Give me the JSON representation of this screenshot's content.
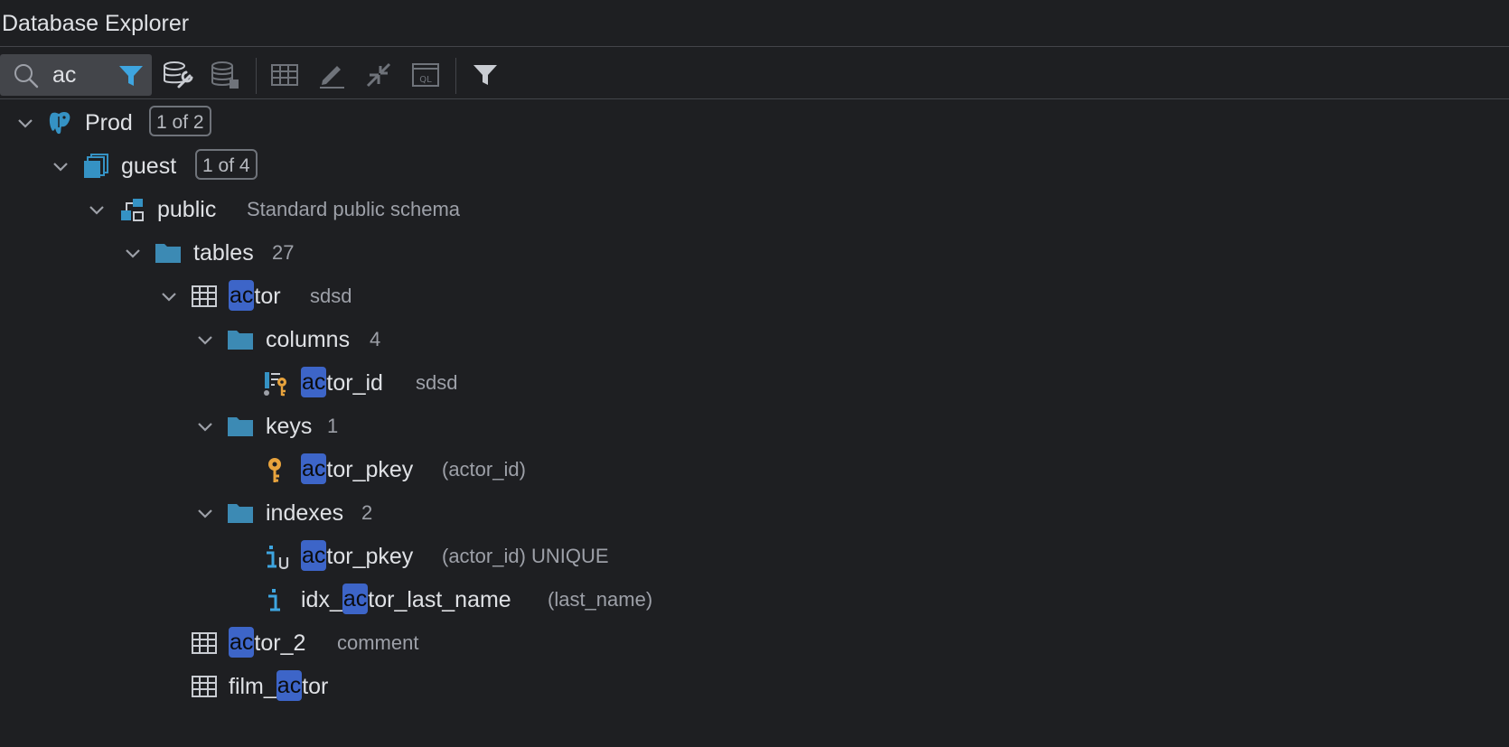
{
  "window": {
    "title": "Database Explorer"
  },
  "search": {
    "value": "ac"
  },
  "colors": {
    "accent": "#3d65c8",
    "icon_blue": "#3592c4",
    "key_yellow": "#e8a33d",
    "bg": "#1e1f22"
  },
  "toolbar": {
    "icons": [
      "data-source-properties-icon",
      "database-icon",
      "table-icon",
      "edit-icon",
      "jump-to-icon",
      "sql-console-icon",
      "filter-icon"
    ]
  },
  "tree": {
    "prod": {
      "label": "Prod",
      "badge": "1 of 2"
    },
    "guest": {
      "label": "guest",
      "badge": "1 of 4"
    },
    "public": {
      "label": "public",
      "comment": "Standard public schema"
    },
    "tables": {
      "label": "tables",
      "count": "27"
    },
    "actor": {
      "match": "ac",
      "rest": "tor",
      "comment": "sdsd"
    },
    "columns": {
      "label": "columns",
      "count": "4"
    },
    "actor_id": {
      "match": "ac",
      "rest": "tor_id",
      "comment": "sdsd"
    },
    "keys": {
      "label": "keys",
      "count": "1"
    },
    "actor_pkey_key": {
      "match": "ac",
      "rest": "tor_pkey",
      "comment": "(actor_id)"
    },
    "indexes": {
      "label": "indexes",
      "count": "2"
    },
    "actor_pkey_index": {
      "match": "ac",
      "rest": "tor_pkey",
      "comment": "(actor_id) UNIQUE"
    },
    "idx_actor_last_name": {
      "prefix": "idx_",
      "match": "ac",
      "rest": "tor_last_name",
      "comment": "(last_name)"
    },
    "actor_2": {
      "match": "ac",
      "rest": "tor_2",
      "comment": "comment"
    },
    "film_actor": {
      "prefix": "film_",
      "match": "ac",
      "rest": "tor"
    }
  }
}
